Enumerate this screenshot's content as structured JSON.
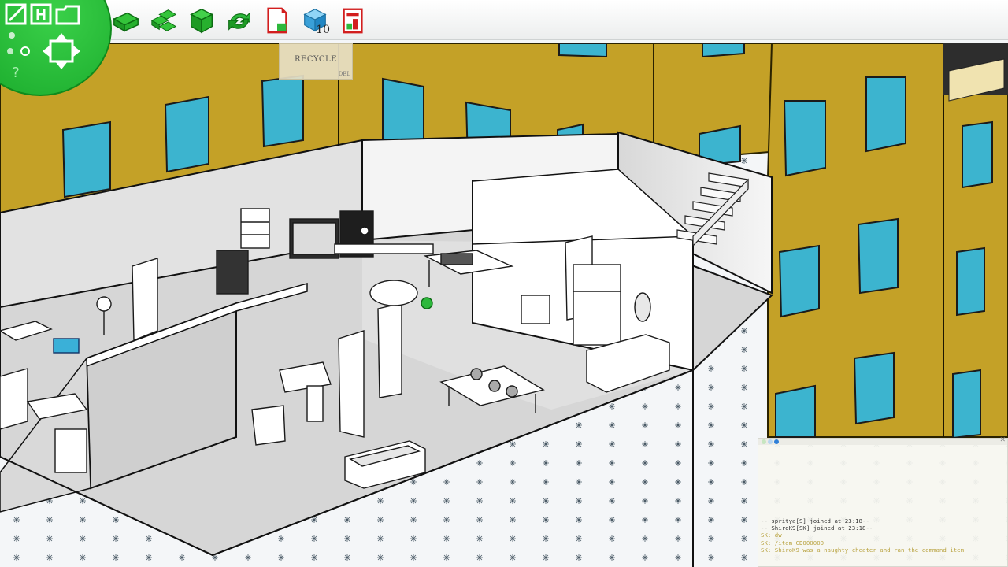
{
  "toolbar": {
    "tools": [
      {
        "id": "place-floor",
        "icon": "green-floor-tile-icon"
      },
      {
        "id": "place-floor-group",
        "icon": "green-stacked-tiles-icon"
      },
      {
        "id": "place-block",
        "icon": "green-cube-icon"
      },
      {
        "id": "rotate",
        "icon": "green-rotate-arrows-icon"
      },
      {
        "id": "document",
        "icon": "red-document-icon"
      },
      {
        "id": "inventory",
        "icon": "blue-cube-icon",
        "count": "10"
      },
      {
        "id": "catalog",
        "icon": "red-book-icon"
      }
    ],
    "inventory_count": "10"
  },
  "nav": {
    "icons": [
      "edit-icon",
      "house-icon",
      "folder-icon",
      "move-arrows-icon",
      "zoom-in-icon",
      "zoom-out-icon",
      "help-icon"
    ]
  },
  "recycle": {
    "label": "RECYCLE",
    "hint": "DEL"
  },
  "chat": {
    "lines": [
      {
        "type": "sys",
        "text": "-- spritya[S] joined at 23:18--"
      },
      {
        "type": "sys",
        "text": "-- ShiroK9[SK] joined at 23:18--"
      },
      {
        "type": "usr",
        "text": "SK: dw"
      },
      {
        "type": "usr",
        "text": "SK: /item CD000000"
      },
      {
        "type": "usr",
        "text": "SK: ShiroK9 was a naughty cheater and ran the command item"
      }
    ]
  },
  "colors": {
    "building_wall": "#c4a127",
    "window_glass": "#3cb4cf",
    "floor": "#f3f5f7",
    "accent_green": "#2db83c"
  }
}
